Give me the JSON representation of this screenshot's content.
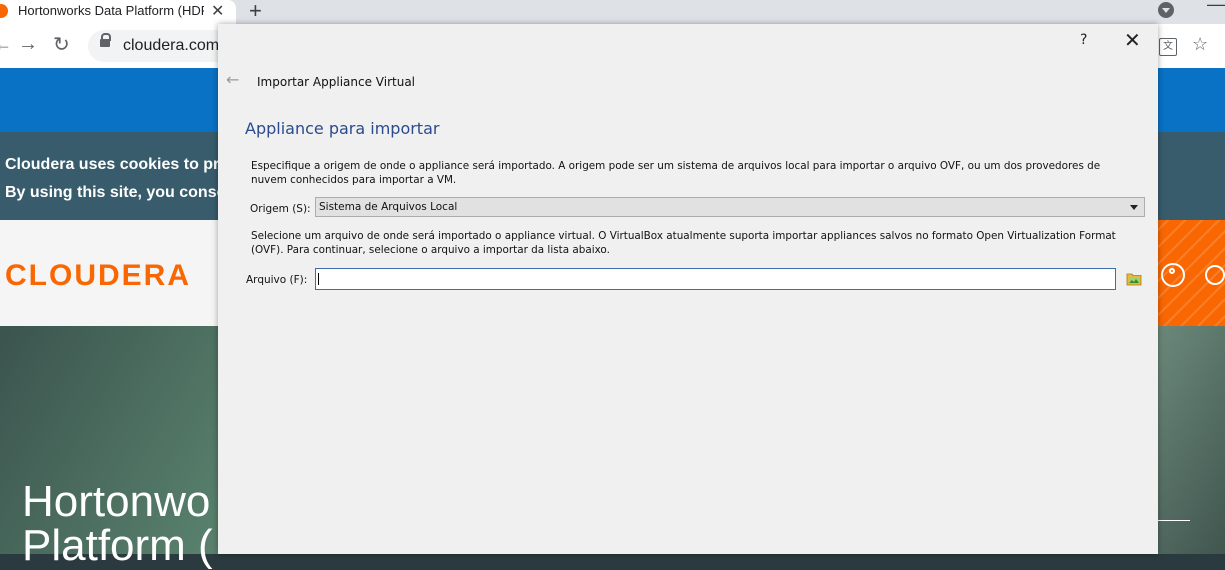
{
  "browser": {
    "tab_title": "Hortonworks Data Platform (HDP",
    "tab_close": "✕",
    "new_tab": "+",
    "url": "cloudera.com/",
    "nav_back": "←",
    "nav_forward": "→",
    "reload": "↻",
    "star": "☆",
    "minimize": "—",
    "translate": "文"
  },
  "page": {
    "cookie_line_1": "Cloudera uses cookies to pro",
    "cookie_line_2": "By using this site, you conser",
    "logo": "CLOUDERA",
    "hero_title": "Hortonwo",
    "hero_title_2": "Platform ("
  },
  "dialog": {
    "help": "?",
    "close": "✕",
    "back": "←",
    "title": "Importar Appliance Virtual",
    "section_title": "Appliance para importar",
    "description_1": "Especifique a origem de onde o appliance será importado. A origem pode ser um sistema de arquivos local para importar o arquivo OVF, ou um dos provedores de nuvem conhecidos para importar a VM.",
    "origin_label": "Origem (S):",
    "origin_value": "Sistema de Arquivos Local",
    "description_2": "Selecione um arquivo de onde será importado o appliance virtual. O VirtualBox atualmente suporta importar appliances salvos no formato Open Virtualization Format (OVF). Para continuar, selecione o arquivo a importar da lista abaixo.",
    "file_label": "Arquivo (F):",
    "file_value": ""
  },
  "colors": {
    "accent_orange": "#f96702",
    "page_blue": "#0a72c4",
    "section_title": "#2a4b8d"
  },
  "icons": [
    "search-icon",
    "user-icon",
    "folder-open-icon",
    "chevron-down-icon",
    "lock-icon",
    "star-icon"
  ]
}
